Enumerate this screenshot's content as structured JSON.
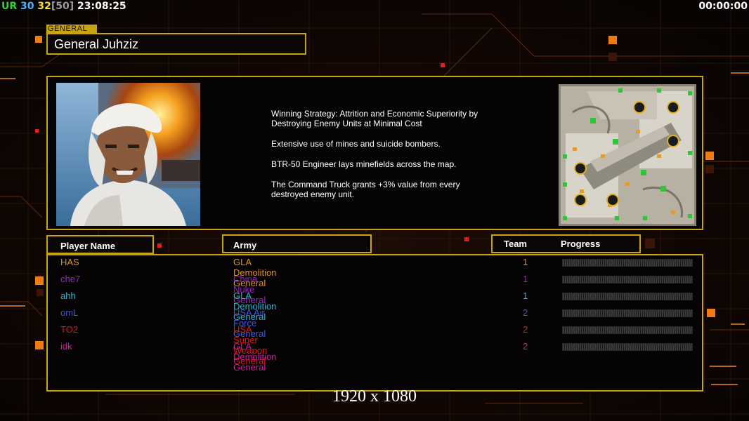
{
  "hud": {
    "ur_label": "UR",
    "fps": "30",
    "fps_current": "32",
    "fps_limit": "[50]",
    "clock": "23:08:25",
    "timer": "00:00:00"
  },
  "general": {
    "tab_label": "GENERAL",
    "name": "General Juhziz",
    "description": [
      "Winning Strategy: Attrition and Economic Superiority by\n Destroying Enemy Units at Minimal Cost",
      "Extensive use of mines and suicide bombers.",
      "BTR-50 Engineer lays minefields across the map.",
      "The Command Truck grants +3% value from every\n destroyed enemy unit."
    ]
  },
  "minimap": {
    "start_positions": [
      "1",
      "2",
      "3",
      "4",
      "5",
      "6"
    ]
  },
  "table": {
    "headers": {
      "player": "Player Name",
      "army": "Army",
      "team": "Team",
      "progress": "Progress"
    },
    "players": [
      {
        "name": "HAS",
        "army": "GLA Demolition General",
        "team": "1",
        "color": "#e3901e",
        "progress": 0
      },
      {
        "name": "che7",
        "army": "China Nuke General",
        "team": "1",
        "color": "#9b22c8",
        "progress": 0
      },
      {
        "name": "ahh",
        "army": "GLA Demolition General",
        "team": "1",
        "color": "#27b5d6",
        "progress": 0
      },
      {
        "name": "omL",
        "army": "USA Air Force General",
        "team": "2",
        "color": "#3e58e0",
        "progress": 0
      },
      {
        "name": "TO2",
        "army": "USA Super Weapon General",
        "team": "2",
        "color": "#e21818",
        "progress": 0
      },
      {
        "name": "idk",
        "army": "GLA Demolition General",
        "team": "2",
        "color": "#d41aa2",
        "progress": 0
      }
    ]
  },
  "resolution_label": "1920 x 1080",
  "colors": {
    "accent_gold": "#c8a414",
    "hud_ur": "#2ed82e",
    "hud_fps": "#4fb3ff",
    "hud_fps_current": "#ffe11a",
    "hud_fps_limit": "#9a9a9a",
    "hud_clock": "#ffffff"
  }
}
